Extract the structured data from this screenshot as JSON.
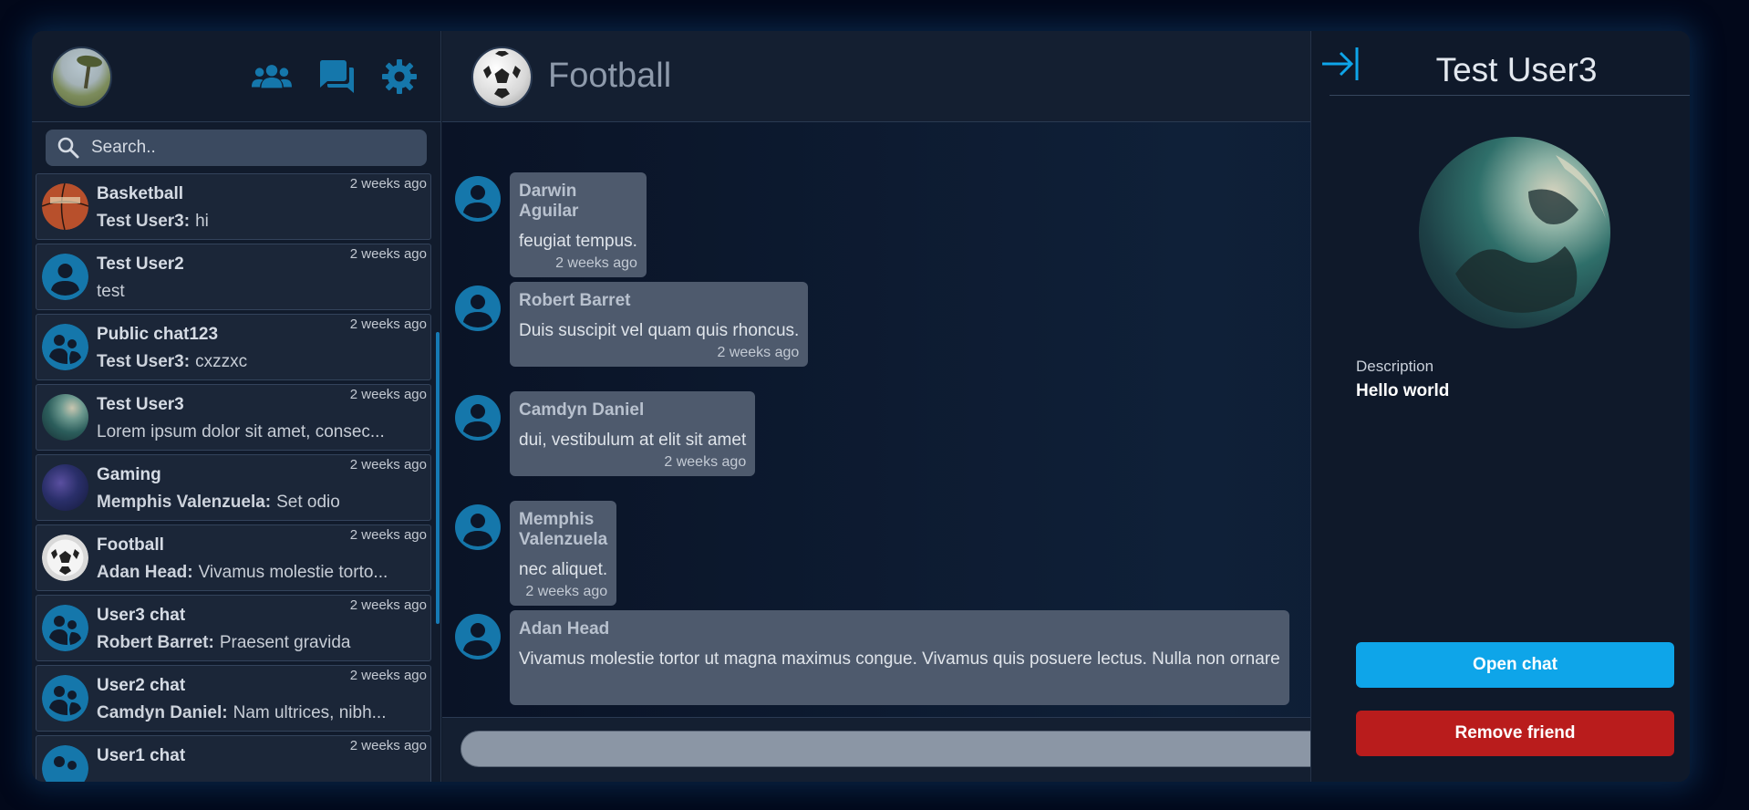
{
  "sidebar": {
    "search_placeholder": "Search..",
    "icons": [
      "friends-icon",
      "chats-icon",
      "settings-icon"
    ],
    "chats": [
      {
        "name": "Basketball",
        "sender": "Test User3:",
        "message": "hi",
        "time": "2 weeks ago",
        "avatar": "basketball"
      },
      {
        "name": "Test User2",
        "sender": "",
        "message": "test",
        "time": "2 weeks ago",
        "avatar": "user"
      },
      {
        "name": "Public chat123",
        "sender": "Test User3:",
        "message": "cxzzxc",
        "time": "2 weeks ago",
        "avatar": "group"
      },
      {
        "name": "Test User3",
        "sender": "",
        "message": "Lorem ipsum dolor sit amet, consec...",
        "time": "2 weeks ago",
        "avatar": "ocean"
      },
      {
        "name": "Gaming",
        "sender": "Memphis Valenzuela:",
        "message": "Set odio",
        "time": "2 weeks ago",
        "avatar": "gaming"
      },
      {
        "name": "Football",
        "sender": "Adan Head:",
        "message": "Vivamus molestie torto...",
        "time": "2 weeks ago",
        "avatar": "football"
      },
      {
        "name": "User3 chat",
        "sender": "Robert Barret:",
        "message": "Praesent gravida",
        "time": "2 weeks ago",
        "avatar": "group"
      },
      {
        "name": "User2 chat",
        "sender": "Camdyn Daniel:",
        "message": "Nam ultrices, nibh...",
        "time": "2 weeks ago",
        "avatar": "group"
      },
      {
        "name": "User1 chat",
        "sender": "",
        "message": "",
        "time": "2 weeks ago",
        "avatar": "group"
      }
    ]
  },
  "main": {
    "title": "Football",
    "messages": [
      {
        "sender": "Darwin Aguilar",
        "text": "feugiat tempus.",
        "time": "2 weeks ago"
      },
      {
        "sender": "Robert Barret",
        "text": "Duis suscipit vel quam quis rhoncus.",
        "time": "2 weeks ago"
      },
      {
        "sender": "Camdyn Daniel",
        "text": "dui, vestibulum at elit sit amet",
        "time": "2 weeks ago"
      },
      {
        "sender": "Memphis Valenzuela",
        "text": "nec aliquet.",
        "time": "2 weeks ago"
      },
      {
        "sender": "Adan Head",
        "text": "Vivamus molestie tortor ut magna maximus congue. Vivamus quis posuere lectus. Nulla non ornare",
        "time": ""
      }
    ],
    "composer_placeholder": ""
  },
  "panel": {
    "title": "Test User3",
    "description_label": "Description",
    "description_value": "Hello world",
    "open_chat_label": "Open chat",
    "remove_friend_label": "Remove friend"
  },
  "colors": {
    "accent": "#1577ab",
    "open_button": "#0ea5e9",
    "remove_button": "#b91c1c"
  }
}
